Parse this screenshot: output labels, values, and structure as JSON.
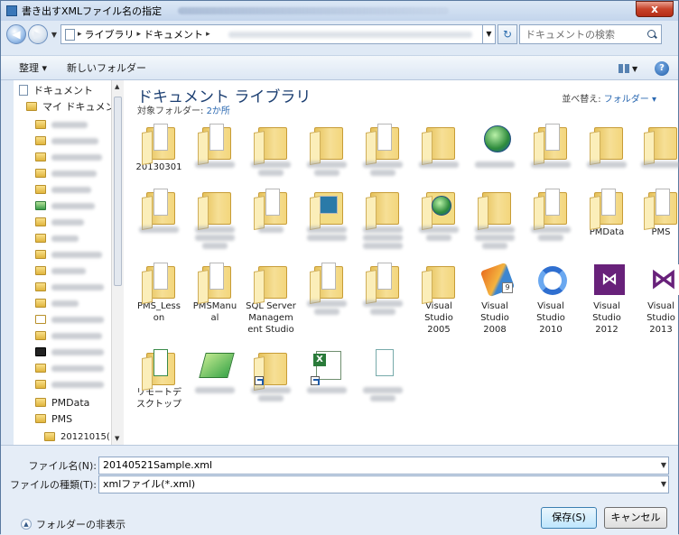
{
  "window": {
    "title": "書き出すXMLファイル名の指定",
    "close_label": "x"
  },
  "address": {
    "crumbs": [
      "ライブラリ",
      "ドキュメント"
    ],
    "search_placeholder": "ドキュメントの検索"
  },
  "toolbar": {
    "organize": "整理 ▾",
    "new_folder": "新しいフォルダー"
  },
  "navpane": {
    "documents": "ドキュメント",
    "my_documents": "マイ ドキュメン",
    "pmdata": "PMData",
    "pms": "PMS",
    "subfolder": "20121015("
  },
  "library": {
    "title": "ドキュメント ライブラリ",
    "subtitle": "対象フォルダー:",
    "locations": "2か所",
    "sort_label": "並べ替え:",
    "sort_value": "フォルダー ▾"
  },
  "items": {
    "i20130301": "20130301",
    "pmdata": "PMData",
    "pms": "PMS",
    "pms_lesson": "PMS_Less on",
    "pmsmanual": "PMSManu al",
    "sql": "SQL Server Managem ent Studio",
    "vs2005": "Visual Studio 2005",
    "vs2008": "Visual Studio 2008",
    "vs2010": "Visual Studio 2010",
    "vs2012": "Visual Studio 2012",
    "vs2013": "Visual Studio 2013",
    "remote": "リモートデ スクトップ"
  },
  "form": {
    "filename_label": "ファイル名(N):",
    "filename_value": "20140521Sample.xml",
    "filetype_label": "ファイルの種類(T):",
    "filetype_value": "xmlファイル(*.xml)",
    "hide_folders": "フォルダーの非表示",
    "save": "保存(S)",
    "cancel": "キャンセル"
  }
}
